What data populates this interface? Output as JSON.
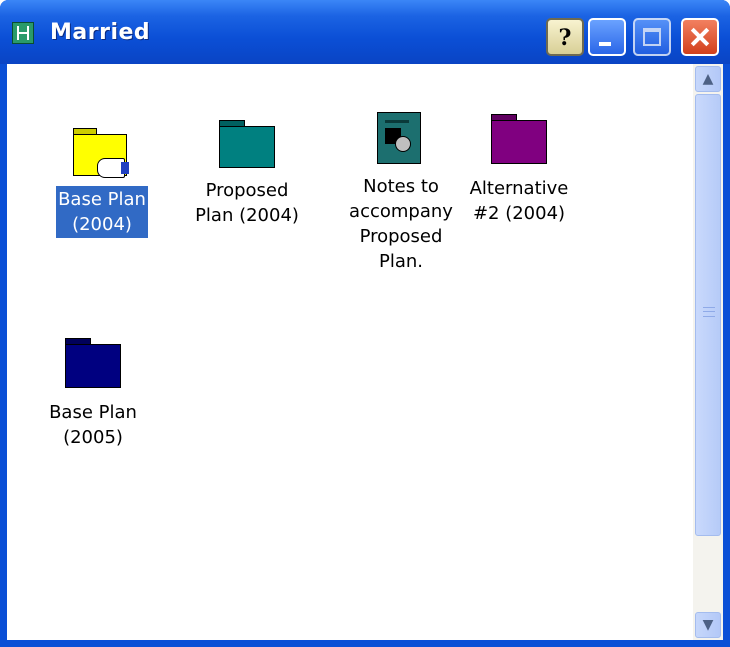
{
  "window": {
    "title": "Married",
    "icon": "application-icon",
    "help_label": "?"
  },
  "scrollbar": {
    "up": "▲",
    "down": "▼"
  },
  "items": [
    {
      "label_line1": "Base Plan",
      "label_line2": "(2004)",
      "icon": "folder-open-icon",
      "color": "#FFFF00",
      "selected": true
    },
    {
      "label_line1": "Proposed",
      "label_line2": "Plan (2004)",
      "icon": "folder-icon",
      "color": "#008080",
      "selected": false
    },
    {
      "label_line1": "Notes to",
      "label_line2": "accompany",
      "label_line3": "Proposed",
      "label_line4": "Plan.",
      "icon": "document-icon",
      "color": "#1c6f6f",
      "selected": false
    },
    {
      "label_line1": "Alternative",
      "label_line2": "#2 (2004)",
      "icon": "folder-icon",
      "color": "#800080",
      "selected": false
    },
    {
      "label_line1": "Base Plan",
      "label_line2": "(2005)",
      "icon": "folder-icon",
      "color": "#000080",
      "selected": false
    }
  ]
}
